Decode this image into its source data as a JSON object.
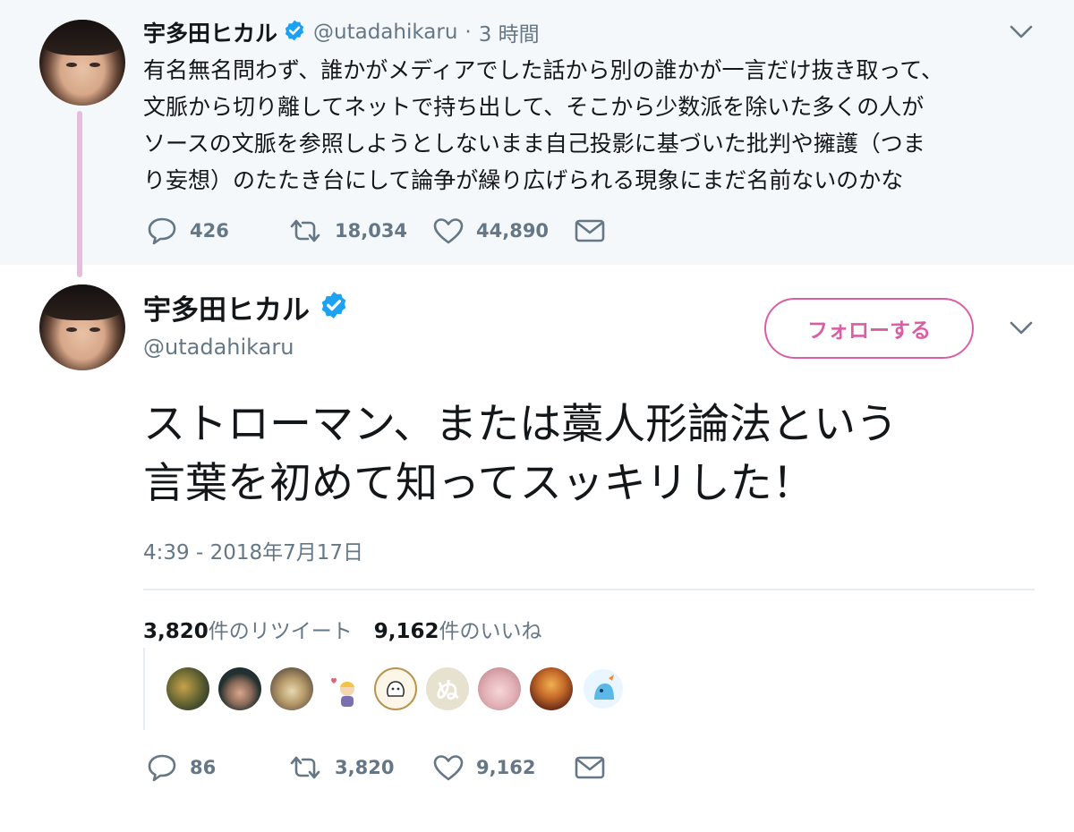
{
  "parent_tweet": {
    "name": "宇多田ヒカル",
    "handle": "@utadahikaru",
    "separator": "·",
    "time": "3 時間",
    "text_lines": [
      "有名無名問わず、誰かがメディアでした話から別の誰かが一言だけ抜き取って、",
      "文脈から切り離してネットで持ち出して、そこから少数派を除いた多くの人が",
      "ソースの文脈を参照しようとしないまま自己投影に基づいた批判や擁護（つま",
      "り妄想）のたたき台にして論争が繰り広げられる現象にまだ名前ないのかな"
    ],
    "replies": "426",
    "retweets": "18,034",
    "likes": "44,890"
  },
  "main_tweet": {
    "name": "宇多田ヒカル",
    "handle": "@utadahikaru",
    "follow_label": "フォローする",
    "text_lines": [
      "ストローマン、または藁人形論法という",
      "言葉を初めて知ってスッキリした！"
    ],
    "date": "4:39 - 2018年7月17日",
    "retweet_count": "3,820",
    "retweet_label": "件のリツイート",
    "like_count": "9,162",
    "like_label": "件のいいね",
    "liker_avatars": 9,
    "replies": "86",
    "retweets": "3,820",
    "likes": "9,162"
  },
  "icons": {
    "verified": "verified-badge-icon",
    "reply": "reply-icon",
    "retweet": "retweet-icon",
    "like": "heart-icon",
    "dm": "envelope-icon",
    "caret": "chevron-down-icon"
  },
  "colors": {
    "accent_pink": "#d95ea6",
    "thread_line": "#e6bddb",
    "verified_blue": "#1da1f2",
    "secondary_text": "#657786",
    "parent_bg": "#f5f8fa"
  }
}
